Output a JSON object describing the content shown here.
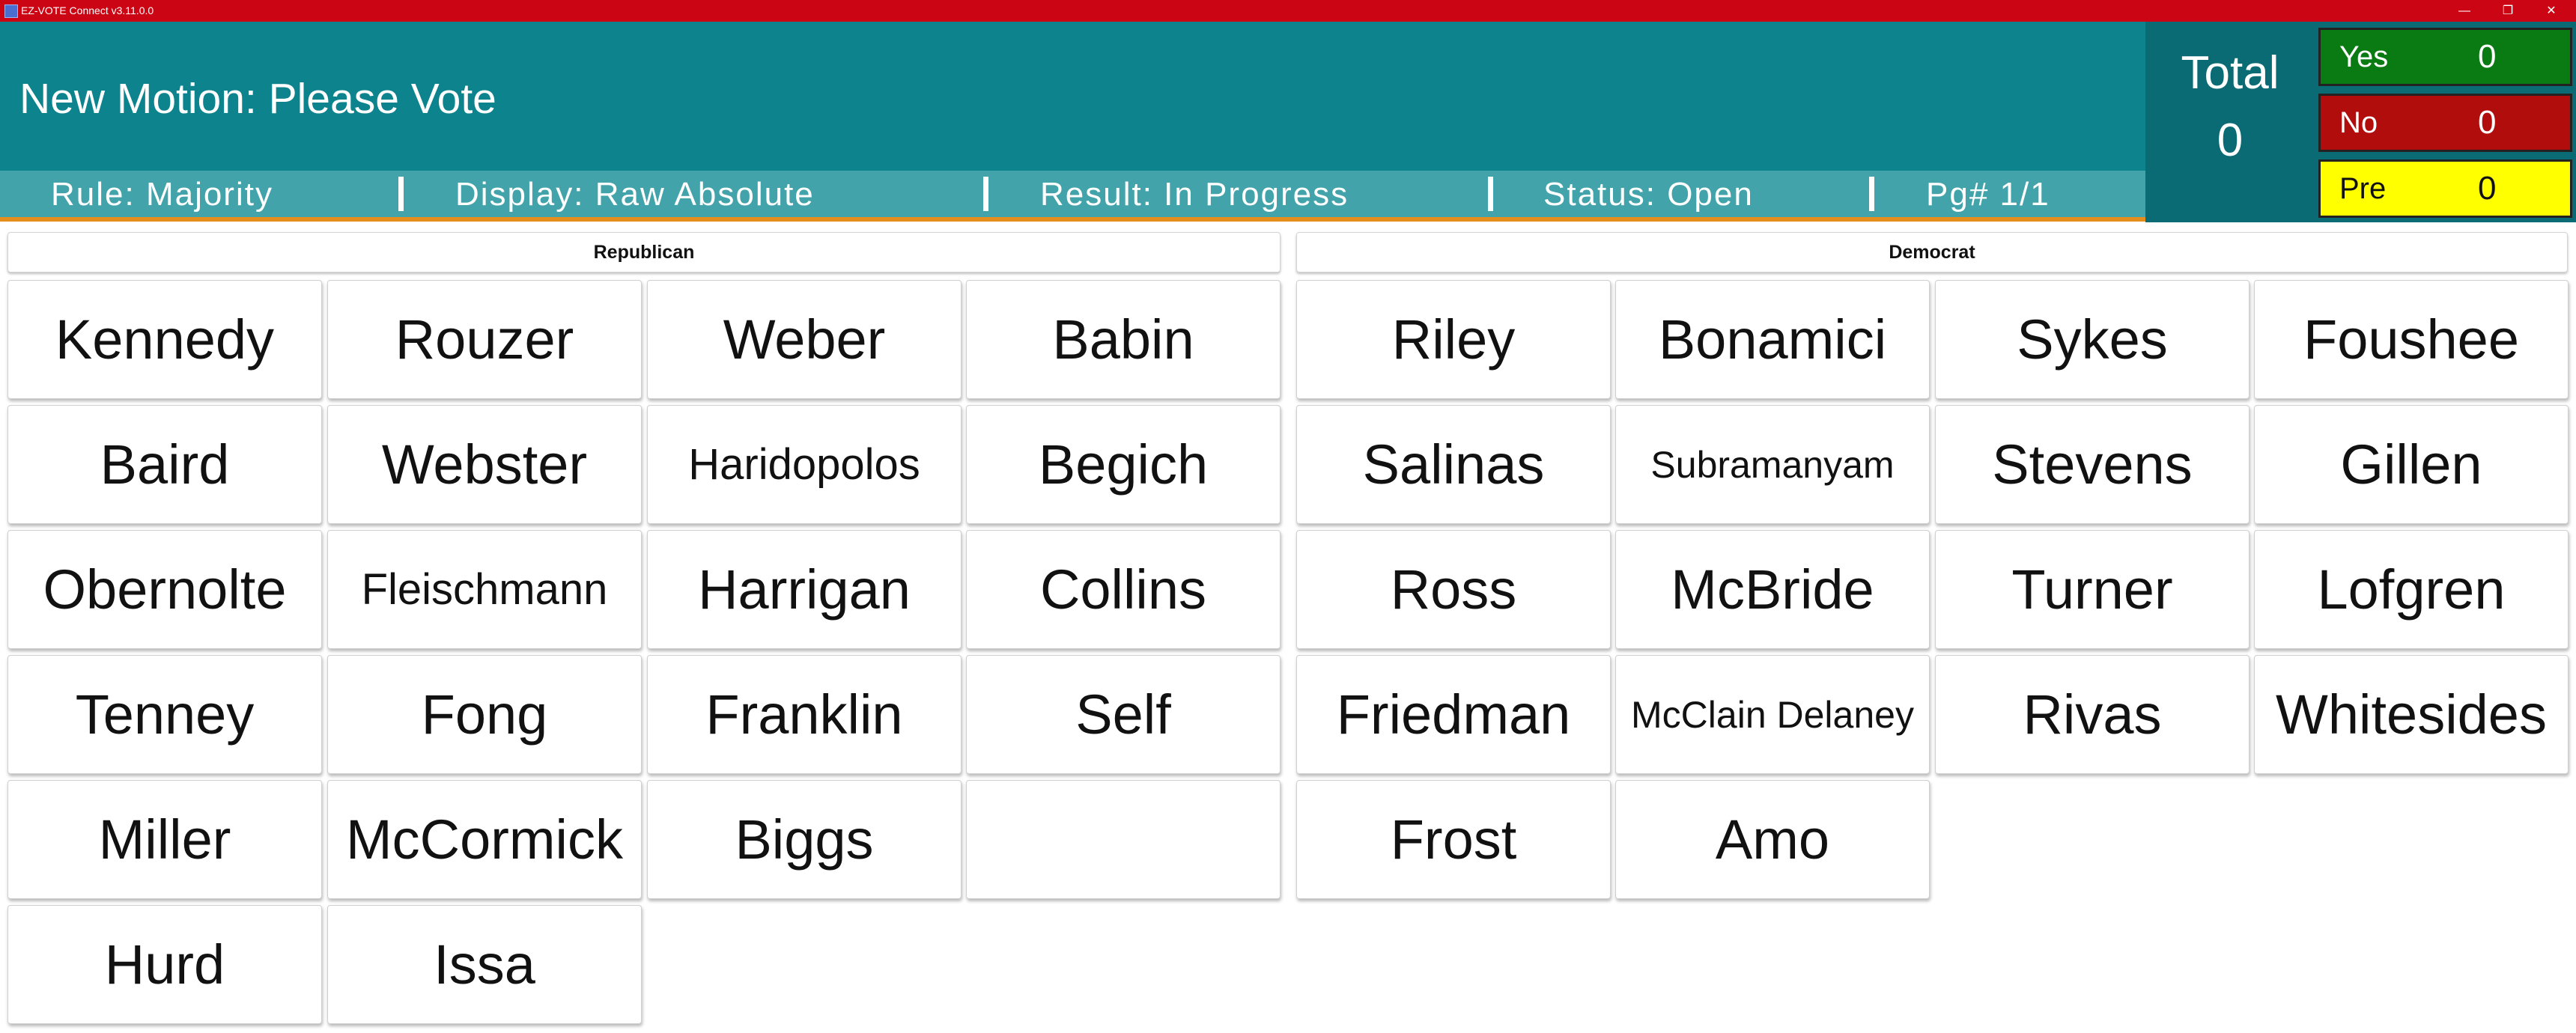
{
  "window": {
    "title": "EZ-VOTE Connect v3.11.0.0"
  },
  "motion": {
    "title": "New Motion: Please Vote",
    "rule": "Rule: Majority",
    "display": "Display: Raw Absolute",
    "result": "Result: In Progress",
    "status": "Status: Open",
    "page": "Pg# 1/1"
  },
  "totals": {
    "label": "Total",
    "value": "0"
  },
  "tally": {
    "yes": {
      "label": "Yes",
      "value": "0",
      "color": "#0a7a13"
    },
    "no": {
      "label": "No",
      "value": "0",
      "color": "#b20d0d"
    },
    "pre": {
      "label": "Pre",
      "value": "0",
      "color": "#ffff00"
    }
  },
  "parties": {
    "republican": {
      "name": "Republican",
      "members": [
        "Kennedy",
        "Rouzer",
        "Weber",
        "Babin",
        "Baird",
        "Webster",
        "Haridopolos",
        "Begich",
        "Obernolte",
        "Fleischmann",
        "Harrigan",
        "Collins",
        "Tenney",
        "Fong",
        "Franklin",
        "Self",
        "Miller",
        "McCormick",
        "Biggs",
        "",
        "Hurd",
        "Issa"
      ]
    },
    "democrat": {
      "name": "Democrat",
      "members": [
        "Riley",
        "Bonamici",
        "Sykes",
        "Foushee",
        "Salinas",
        "Subramanyam",
        "Stevens",
        "Gillen",
        "Ross",
        "McBride",
        "Turner",
        "Lofgren",
        "Friedman",
        "McClain Delaney",
        "Rivas",
        "Whitesides",
        "Frost",
        "Amo"
      ]
    }
  },
  "colors": {
    "titlebar": "#cc0514",
    "header": "#0d848d",
    "infobar": "#43a3ab",
    "accent": "#e48e1d"
  }
}
